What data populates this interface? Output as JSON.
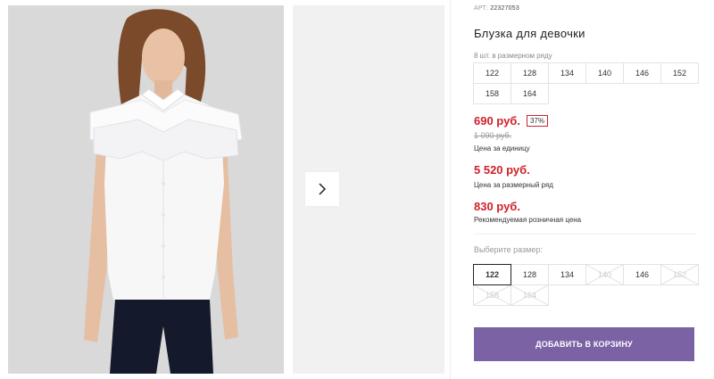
{
  "product": {
    "article_prefix": "АРТ:",
    "article": "22327053",
    "title": "Блузка для девочки",
    "pack_label": "8 шт. в размерном ряду",
    "pack_sizes": [
      "122",
      "128",
      "134",
      "140",
      "146",
      "152",
      "158",
      "164"
    ]
  },
  "price": {
    "current": "690 руб.",
    "discount": "37%",
    "old": "1 090 руб.",
    "unit_caption": "Цена за единицу",
    "set_price": "5 520 руб.",
    "set_caption": "Цена за размерный ряд",
    "rrp": "830 руб.",
    "rrp_caption": "Рекомендуемая розничная цена"
  },
  "size_picker": {
    "label": "Выберите размер:",
    "options": [
      {
        "value": "122",
        "state": "selected"
      },
      {
        "value": "128",
        "state": "available"
      },
      {
        "value": "134",
        "state": "available"
      },
      {
        "value": "140",
        "state": "disabled"
      },
      {
        "value": "146",
        "state": "available"
      },
      {
        "value": "152",
        "state": "disabled"
      },
      {
        "value": "158",
        "state": "disabled"
      },
      {
        "value": "164",
        "state": "disabled"
      }
    ]
  },
  "actions": {
    "add_to_cart": "ДОБАВИТЬ В КОРЗИНУ"
  },
  "gallery": {
    "next_icon": "chevron-right-icon"
  },
  "colors": {
    "price_red": "#d0202a",
    "button_purple": "#7b62a5"
  }
}
